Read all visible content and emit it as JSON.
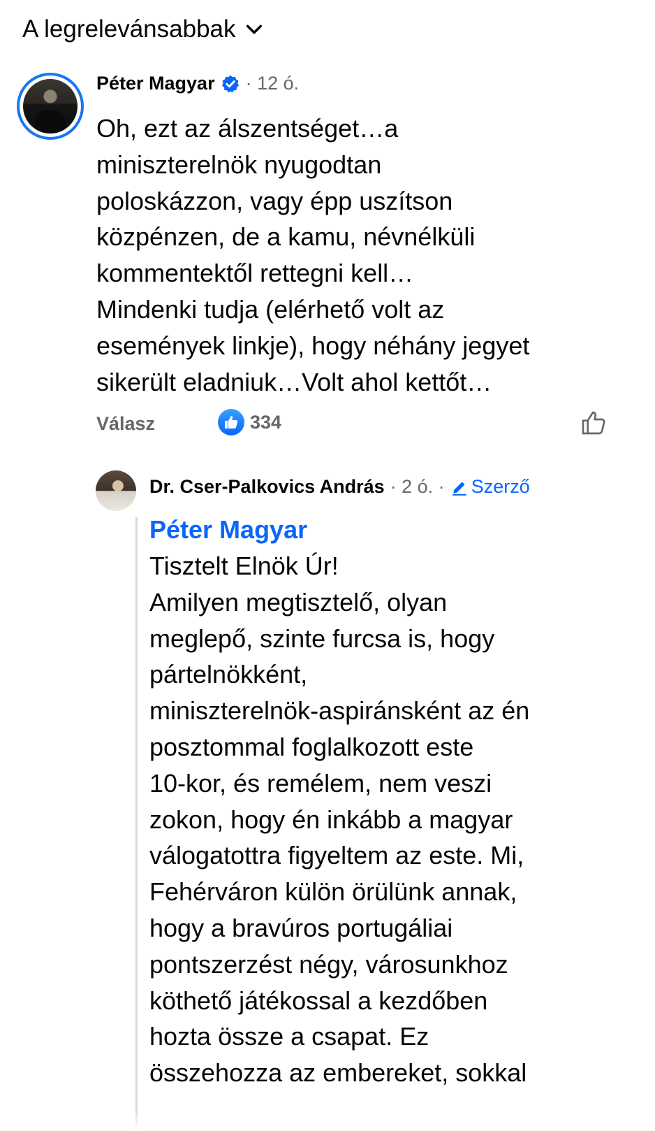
{
  "sort": {
    "label": "A legrelevánsabbak",
    "icon": "chevron-down-icon"
  },
  "comment1": {
    "author": "Péter Magyar",
    "verified_icon": "verified-badge-icon",
    "time": "· 12 ó.",
    "lines": [
      "Oh, ezt az álszentséget…a",
      "miniszterelnök nyugodtan",
      "poloskázzon, vagy épp uszítson",
      "közpénzen, de a kamu, névnélküli",
      "kommentektől rettegni kell…",
      "Mindenki tudja (elérhető volt az",
      "események linkje), hogy néhány jegyet",
      "sikerült eladniuk…Volt ahol kettőt…"
    ],
    "reply_label": "Válasz",
    "like_count": "334",
    "like_color": "#0866ff"
  },
  "comment2": {
    "author": "Dr. Cser-Palkovics András",
    "time": "· 2 ó. ·",
    "author_badge": "Szerző",
    "author_badge_icon": "pencil-icon",
    "mention": "Péter Magyar",
    "lines": [
      "Tisztelt Elnök Úr!",
      "Amilyen megtisztelő, olyan",
      "meglepő, szinte furcsa is, hogy",
      "pártelnökként,",
      "miniszterelnök-aspiránsként az én",
      "posztommal foglalkozott este",
      "10-kor, és remélem, nem veszi",
      "zokon, hogy én inkább a magyar",
      "válogatottra figyeltem az este. Mi,",
      "Fehérváron külön örülünk annak,",
      "hogy a bravúros portugáliai",
      "pontszerzést négy, városunkhoz",
      "köthető játékossal a kezdőben",
      "hozta össze a csapat. Ez",
      "összehozza az embereket, sokkal"
    ]
  },
  "colors": {
    "accent": "#0866ff",
    "secondary_text": "#65676b",
    "primary_text": "#050505"
  }
}
